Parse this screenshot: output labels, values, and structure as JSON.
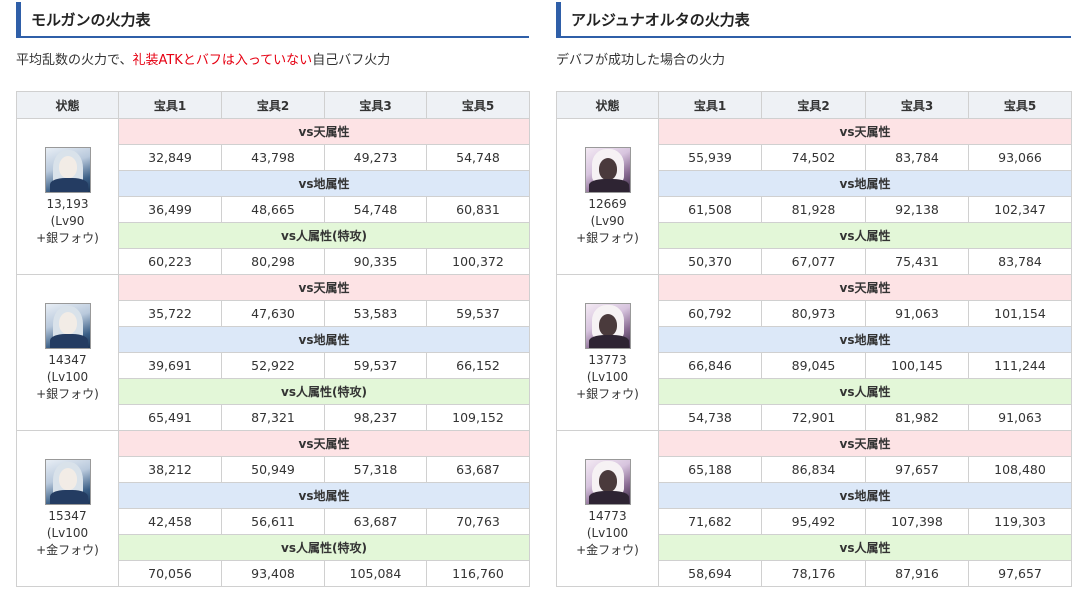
{
  "left": {
    "title": "モルガンの火力表",
    "note_prefix": "平均乱数の火力で、",
    "note_red": "礼装ATKとバフは入っていない",
    "note_suffix": "自己バフ火力",
    "headers": [
      "状態",
      "宝具1",
      "宝具2",
      "宝具3",
      "宝具5"
    ],
    "groups": [
      {
        "avatar": "morgan-portrait-icon",
        "atk": "13,193",
        "lv": "(Lv90",
        "fou": "+銀フォウ)",
        "sky_label": "vs天属性",
        "sky": [
          "32,849",
          "43,798",
          "49,273",
          "54,748"
        ],
        "earth_label": "vs地属性",
        "earth": [
          "36,499",
          "48,665",
          "54,748",
          "60,831"
        ],
        "human_label": "vs人属性(特攻)",
        "human": [
          "60,223",
          "80,298",
          "90,335",
          "100,372"
        ]
      },
      {
        "avatar": "morgan-portrait-icon",
        "atk": "14347",
        "lv": "(Lv100",
        "fou": "+銀フォウ)",
        "sky_label": "vs天属性",
        "sky": [
          "35,722",
          "47,630",
          "53,583",
          "59,537"
        ],
        "earth_label": "vs地属性",
        "earth": [
          "39,691",
          "52,922",
          "59,537",
          "66,152"
        ],
        "human_label": "vs人属性(特攻)",
        "human": [
          "65,491",
          "87,321",
          "98,237",
          "109,152"
        ]
      },
      {
        "avatar": "morgan-portrait-icon",
        "atk": "15347",
        "lv": "(Lv100",
        "fou": "+金フォウ)",
        "sky_label": "vs天属性",
        "sky": [
          "38,212",
          "50,949",
          "57,318",
          "63,687"
        ],
        "earth_label": "vs地属性",
        "earth": [
          "42,458",
          "56,611",
          "63,687",
          "70,763"
        ],
        "human_label": "vs人属性(特攻)",
        "human": [
          "70,056",
          "93,408",
          "105,084",
          "116,760"
        ]
      }
    ]
  },
  "right": {
    "title": "アルジュナオルタの火力表",
    "note": "デバフが成功した場合の火力",
    "headers": [
      "状態",
      "宝具1",
      "宝具2",
      "宝具3",
      "宝具5"
    ],
    "groups": [
      {
        "avatar": "arjuna-alter-portrait-icon",
        "atk": "12669",
        "lv": "(Lv90",
        "fou": "+銀フォウ)",
        "sky_label": "vs天属性",
        "sky": [
          "55,939",
          "74,502",
          "83,784",
          "93,066"
        ],
        "earth_label": "vs地属性",
        "earth": [
          "61,508",
          "81,928",
          "92,138",
          "102,347"
        ],
        "human_label": "vs人属性",
        "human": [
          "50,370",
          "67,077",
          "75,431",
          "83,784"
        ]
      },
      {
        "avatar": "arjuna-alter-portrait-icon",
        "atk": "13773",
        "lv": "(Lv100",
        "fou": "+銀フォウ)",
        "sky_label": "vs天属性",
        "sky": [
          "60,792",
          "80,973",
          "91,063",
          "101,154"
        ],
        "earth_label": "vs地属性",
        "earth": [
          "66,846",
          "89,045",
          "100,145",
          "111,244"
        ],
        "human_label": "vs人属性",
        "human": [
          "54,738",
          "72,901",
          "81,982",
          "91,063"
        ]
      },
      {
        "avatar": "arjuna-alter-portrait-icon",
        "atk": "14773",
        "lv": "(Lv100",
        "fou": "+金フォウ)",
        "sky_label": "vs天属性",
        "sky": [
          "65,188",
          "86,834",
          "97,657",
          "108,480"
        ],
        "earth_label": "vs地属性",
        "earth": [
          "71,682",
          "95,492",
          "107,398",
          "119,303"
        ],
        "human_label": "vs人属性",
        "human": [
          "58,694",
          "78,176",
          "87,916",
          "97,657"
        ]
      }
    ]
  }
}
